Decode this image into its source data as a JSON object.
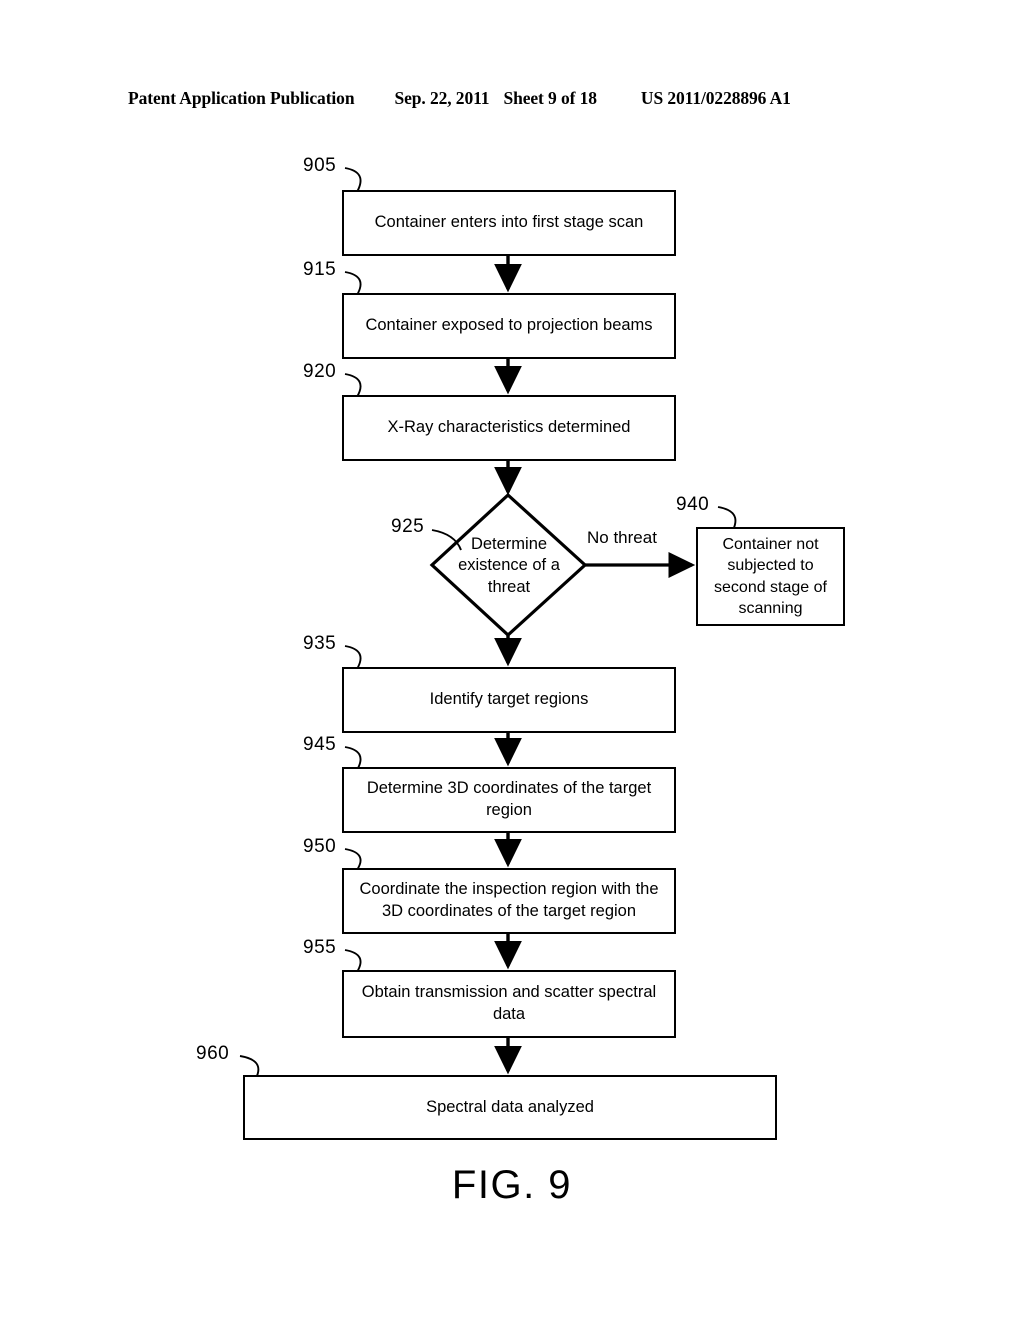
{
  "header": {
    "publication": "Patent Application Publication",
    "date": "Sep. 22, 2011",
    "sheet": "Sheet 9 of 18",
    "publication_number": "US 2011/0228896 A1"
  },
  "figure": {
    "caption": "FIG. 9"
  },
  "diagram": {
    "type": "flowchart",
    "nodes": [
      {
        "ref": "905",
        "shape": "process",
        "text": "Container enters into first stage scan"
      },
      {
        "ref": "915",
        "shape": "process",
        "text": "Container exposed to projection beams"
      },
      {
        "ref": "920",
        "shape": "process",
        "text": "X-Ray characteristics determined"
      },
      {
        "ref": "925",
        "shape": "decision",
        "text": "Determine existence of a threat"
      },
      {
        "ref": "940",
        "shape": "process",
        "text": "Container not subjected to second stage of scanning"
      },
      {
        "ref": "935",
        "shape": "process",
        "text": "Identify target regions"
      },
      {
        "ref": "945",
        "shape": "process",
        "text": "Determine 3D coordinates of the target region"
      },
      {
        "ref": "950",
        "shape": "process",
        "text": "Coordinate the inspection region with the 3D coordinates of the target region"
      },
      {
        "ref": "955",
        "shape": "process",
        "text": "Obtain transmission and scatter spectral data"
      },
      {
        "ref": "960",
        "shape": "process",
        "text": "Spectral data analyzed"
      }
    ],
    "edges": [
      {
        "from": "905",
        "to": "915",
        "label": ""
      },
      {
        "from": "915",
        "to": "920",
        "label": ""
      },
      {
        "from": "920",
        "to": "925",
        "label": ""
      },
      {
        "from": "925",
        "to": "940",
        "label": "No threat"
      },
      {
        "from": "925",
        "to": "935",
        "label": ""
      },
      {
        "from": "935",
        "to": "945",
        "label": ""
      },
      {
        "from": "945",
        "to": "950",
        "label": ""
      },
      {
        "from": "950",
        "to": "955",
        "label": ""
      },
      {
        "from": "955",
        "to": "960",
        "label": ""
      }
    ],
    "branch_labels": {
      "no_threat": "No threat"
    },
    "colors": {
      "line": "#000000",
      "fill": "#ffffff",
      "text": "#000000"
    }
  }
}
